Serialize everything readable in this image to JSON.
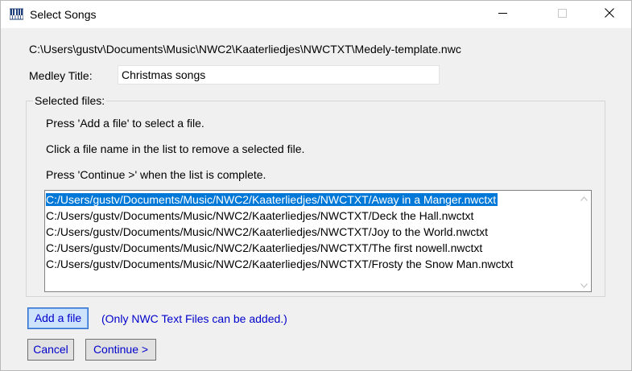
{
  "window": {
    "title": "Select Songs",
    "icons": {
      "app": "piano-keys-icon",
      "minimize": "minimize-icon",
      "maximize": "maximize-icon",
      "close": "close-icon"
    }
  },
  "path": "C:\\Users\\gustv\\Documents\\Music\\NWC2\\Kaaterliedjes\\NWCTXT\\Medely-template.nwc",
  "medley": {
    "label": "Medley Title:",
    "value": "Christmas songs"
  },
  "selected_files": {
    "label": "Selected files:",
    "instructions": [
      "Press 'Add a file' to select a file.",
      "Click a file name in the list to remove a selected file.",
      "Press 'Continue >' when the list is complete."
    ],
    "files": [
      "C:/Users/gustv/Documents/Music/NWC2/Kaaterliedjes/NWCTXT/Away in a Manger.nwctxt",
      "C:/Users/gustv/Documents/Music/NWC2/Kaaterliedjes/NWCTXT/Deck the Hall.nwctxt",
      "C:/Users/gustv/Documents/Music/NWC2/Kaaterliedjes/NWCTXT/Joy to the World.nwctxt",
      "C:/Users/gustv/Documents/Music/NWC2/Kaaterliedjes/NWCTXT/The first nowell.nwctxt",
      "C:/Users/gustv/Documents/Music/NWC2/Kaaterliedjes/NWCTXT/Frosty the Snow Man.nwctxt"
    ],
    "selected_index": 0
  },
  "buttons": {
    "add": "Add a file",
    "note": "(Only NWC Text Files can be added.)",
    "cancel": "Cancel",
    "continue": "Continue >"
  },
  "colors": {
    "selection": "#0078d7",
    "button_text": "#0000cc",
    "dialog_bg": "#f0f0f0"
  }
}
